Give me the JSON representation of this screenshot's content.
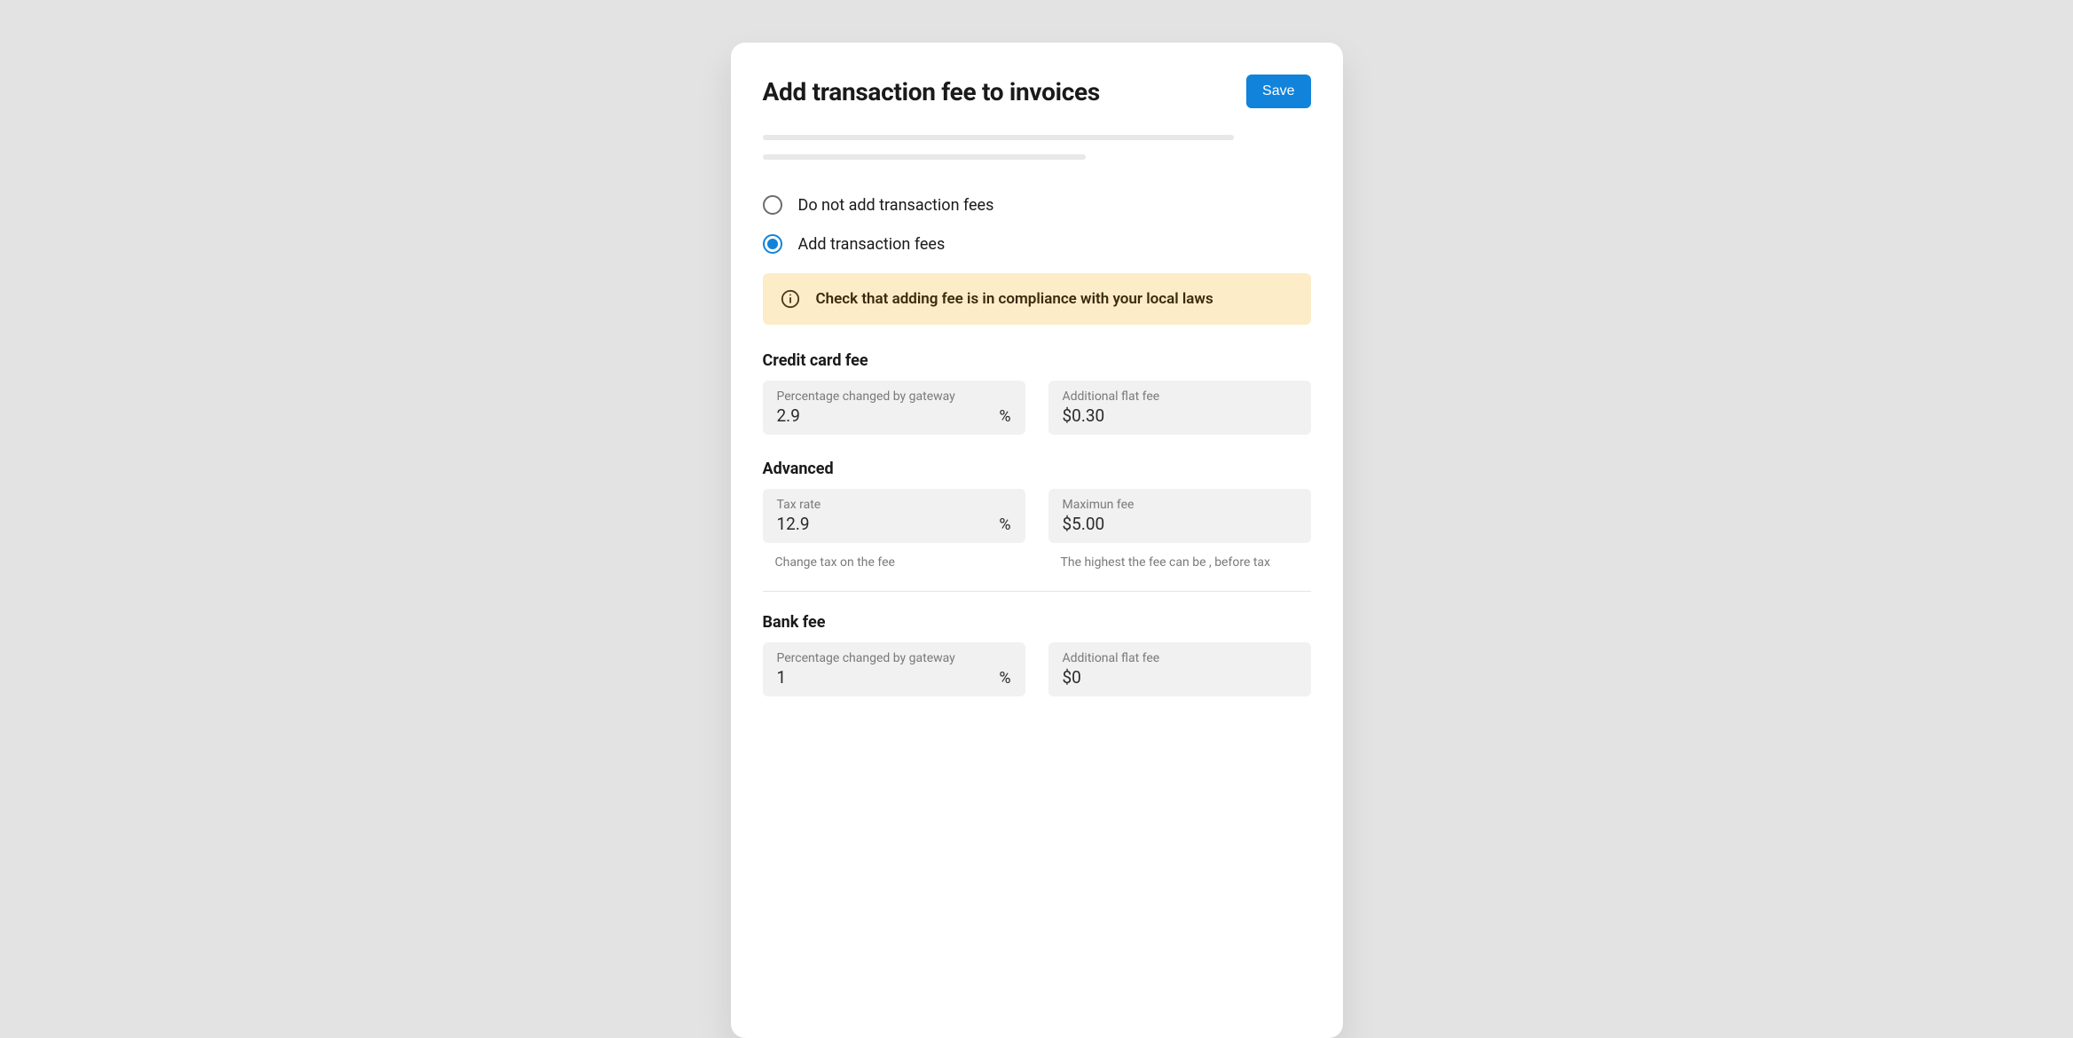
{
  "header": {
    "title": "Add transaction fee to invoices",
    "save_label": "Save"
  },
  "options": {
    "do_not_add": "Do not add transaction fees",
    "add": "Add transaction fees"
  },
  "alert": {
    "text": "Check that adding fee is in compliance with your local laws"
  },
  "sections": {
    "credit_card": {
      "title": "Credit card fee",
      "percentage": {
        "label": "Percentage changed by gateway",
        "value": "2.9",
        "suffix": "%"
      },
      "flat": {
        "label": "Additional flat fee",
        "value": "$0.30"
      }
    },
    "advanced": {
      "title": "Advanced",
      "tax_rate": {
        "label": "Tax rate",
        "value": "12.9",
        "suffix": "%",
        "hint": "Change tax on the fee"
      },
      "max_fee": {
        "label": "Maximun fee",
        "value": "$5.00",
        "hint": "The highest the fee can be , before tax"
      }
    },
    "bank": {
      "title": "Bank fee",
      "percentage": {
        "label": "Percentage changed by gateway",
        "value": "1",
        "suffix": "%"
      },
      "flat": {
        "label": "Additional flat fee",
        "value": "$0"
      }
    }
  }
}
